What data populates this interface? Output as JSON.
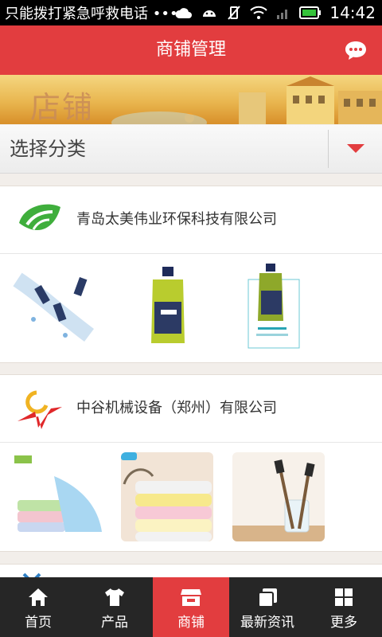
{
  "status_bar": {
    "notification": "只能拨打紧急呼救电话 •••",
    "time": "14:42"
  },
  "header": {
    "title": "商铺管理",
    "message_icon": "chat-bubble-icon"
  },
  "banner": {
    "text": "店铺"
  },
  "category_select": {
    "label": "选择分类",
    "arrow_icon": "caret-down-icon"
  },
  "shops": [
    {
      "name": "青岛太美伟业环保科技有限公司",
      "logo_icon": "green-leaf-logo-icon",
      "products": [
        "water-bottles-splash-image",
        "green-olive-oil-bottle-image",
        "oceans-oil-bottle-image"
      ]
    },
    {
      "name": "中谷机械设备（郑州）有限公司",
      "logo_icon": "star-arc-logo-icon",
      "products": [
        "folded-towels-image",
        "stacked-towels-image",
        "toothbrushes-in-glass-image"
      ]
    }
  ],
  "nav": [
    {
      "label": "首页",
      "icon": "home-icon",
      "active": false
    },
    {
      "label": "产品",
      "icon": "tshirt-icon",
      "active": false
    },
    {
      "label": "商铺",
      "icon": "store-icon",
      "active": true
    },
    {
      "label": "最新资讯",
      "icon": "news-icon",
      "active": false
    },
    {
      "label": "更多",
      "icon": "grid-icon",
      "active": false
    }
  ],
  "colors": {
    "accent": "#e23d3f",
    "nav_bg": "#262626",
    "page_bg": "#f2eeea"
  }
}
